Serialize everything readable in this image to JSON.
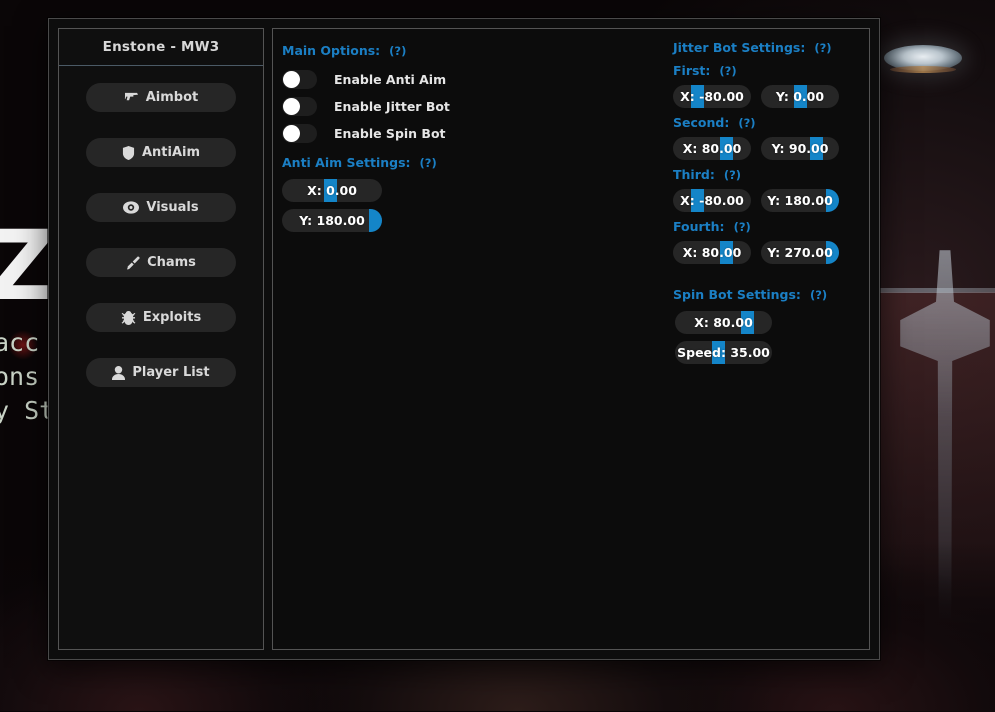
{
  "background": {
    "site_heading": "Z",
    "site_lines": [
      "acc",
      "ons",
      "y St"
    ]
  },
  "window": {
    "title": "Enstone - MW3"
  },
  "sidebar": {
    "items": [
      {
        "label": "Aimbot",
        "icon": "pistol-icon"
      },
      {
        "label": "AntiAim",
        "icon": "shield-icon"
      },
      {
        "label": "Visuals",
        "icon": "eye-icon"
      },
      {
        "label": "Chams",
        "icon": "paintbrush-icon"
      },
      {
        "label": "Exploits",
        "icon": "bug-icon"
      },
      {
        "label": "Player List",
        "icon": "user-icon"
      }
    ]
  },
  "main_options": {
    "heading": "Main Options:",
    "hint": "(?)",
    "toggles": [
      {
        "label": "Enable Anti Aim",
        "state": "off"
      },
      {
        "label": "Enable Jitter Bot",
        "state": "off"
      },
      {
        "label": "Enable Spin Bot",
        "state": "off"
      }
    ]
  },
  "anti_aim_settings": {
    "heading": "Anti Aim Settings:",
    "hint": "(?)",
    "sliders": [
      {
        "label": "X: 0.00",
        "fill_percent": 48
      },
      {
        "label": "Y: 180.00",
        "fill_percent": 100
      }
    ]
  },
  "jitter_bot_settings": {
    "heading": "Jitter Bot Settings:",
    "hint": "(?)",
    "groups": [
      {
        "label": "First:",
        "hint": "(?)",
        "sliders": [
          {
            "label": "X: -80.00",
            "fill_percent": 27
          },
          {
            "label": "Y: 0.00",
            "fill_percent": 50
          }
        ]
      },
      {
        "label": "Second:",
        "hint": "(?)",
        "sliders": [
          {
            "label": "X: 80.00",
            "fill_percent": 73
          },
          {
            "label": "Y: 90.00",
            "fill_percent": 75
          }
        ]
      },
      {
        "label": "Third:",
        "hint": "(?)",
        "sliders": [
          {
            "label": "X: -80.00",
            "fill_percent": 27
          },
          {
            "label": "Y: 180.00",
            "fill_percent": 100
          }
        ]
      },
      {
        "label": "Fourth:",
        "hint": "(?)",
        "sliders": [
          {
            "label": "X: 80.00",
            "fill_percent": 73
          },
          {
            "label": "Y: 270.00",
            "fill_percent": 100
          }
        ]
      }
    ]
  },
  "spin_bot_settings": {
    "heading": "Spin Bot Settings:",
    "hint": "(?)",
    "sliders": [
      {
        "label": "X: 80.00",
        "fill_percent": 78
      },
      {
        "label": "Speed: 35.00",
        "fill_percent": 44
      }
    ]
  },
  "colors": {
    "accent_blue": "#1485c8",
    "heading_blue": "#1b7fc4",
    "panel_bg": "#0c0c0c",
    "window_bg": "#0d0d0d",
    "slider_track": "#262626",
    "button_bg": "#262626",
    "text_light": "#e6e6e6"
  }
}
